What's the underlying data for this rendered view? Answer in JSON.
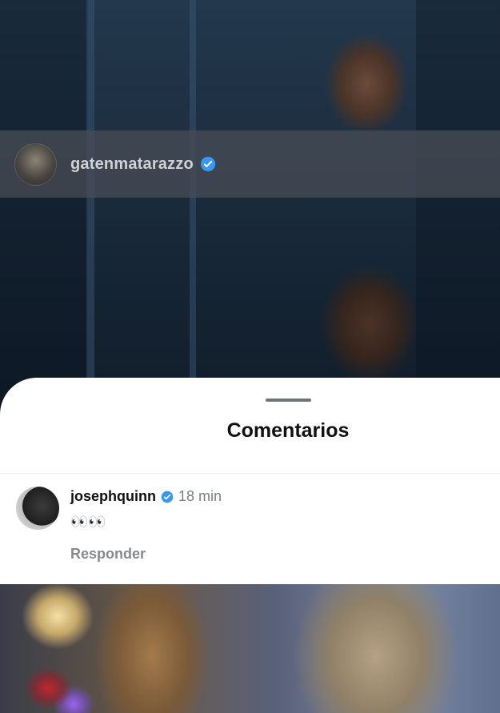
{
  "post": {
    "author": "gatenmatarazzo"
  },
  "sheet": {
    "title": "Comentarios"
  },
  "comments": [
    {
      "user": "josephquinn",
      "time": "18 min",
      "body": "👀👀",
      "reply_label": "Responder"
    }
  ],
  "colors": {
    "verified_blue": "#3897f0",
    "sheet_bg": "#ffffff",
    "muted_text": "#858a90"
  },
  "icons": {
    "verified": "verified-badge-icon"
  }
}
